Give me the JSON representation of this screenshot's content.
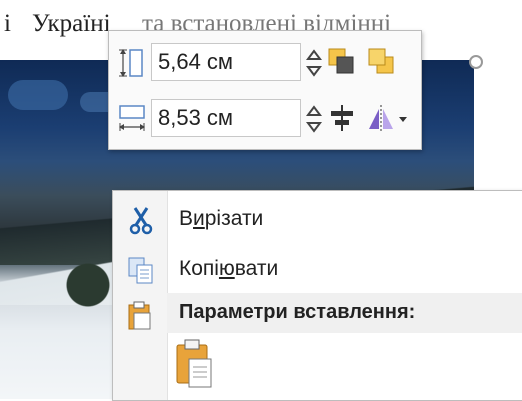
{
  "document": {
    "text_left": "і",
    "text_word": "Україні",
    "text_right": "та встановлені відмінні"
  },
  "size_toolbar": {
    "height_value": "5,64 см",
    "width_value": "8,53 см",
    "icons": [
      "shape-height-icon",
      "shape-width-icon",
      "bring-forward-icon",
      "send-backward-icon",
      "align-icon",
      "rotate-icon"
    ]
  },
  "context_menu": {
    "cut": {
      "pre": "В",
      "underline": "и",
      "post": "різати"
    },
    "copy": {
      "pre": "Копі",
      "underline": "ю",
      "post": "вати"
    },
    "paste_header": "Параметри вставлення:"
  },
  "colors": {
    "menu_bg": "#ffffff",
    "gutter": "#f4f4f4",
    "header_bg": "#f0f0f0",
    "accent_blue": "#1f5fa8",
    "icon_orange": "#e8a33a"
  }
}
